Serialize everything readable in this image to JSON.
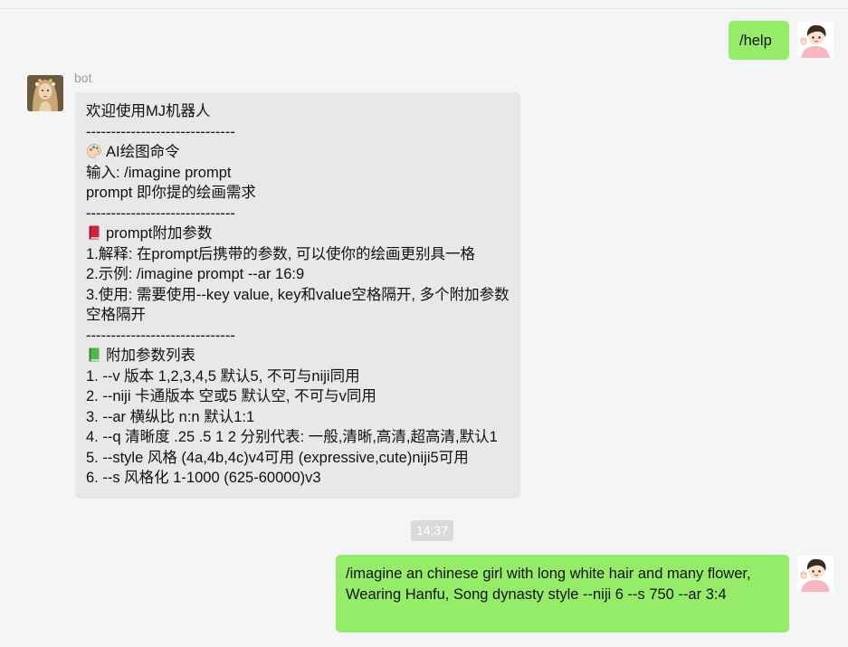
{
  "chat": {
    "user_help_message": "/help",
    "bot_sender_name": "bot",
    "bot_reply_lines": [
      "欢迎使用MJ机器人",
      "------------------------------",
      "🎨 AI绘图命令",
      "输入: /imagine prompt",
      "prompt 即你提的绘画需求",
      "------------------------------",
      "📕 prompt附加参数",
      "1.解释: 在prompt后携带的参数, 可以使你的绘画更别具一格",
      "2.示例: /imagine prompt --ar 16:9",
      "3.使用: 需要使用--key value, key和value空格隔开, 多个附加参数空格隔开",
      "------------------------------",
      "📗 附加参数列表",
      "1. --v 版本 1,2,3,4,5 默认5, 不可与niji同用",
      "2. --niji 卡通版本 空或5 默认空, 不可与v同用",
      "3. --ar 横纵比 n:n 默认1:1",
      "4. --q 清晰度 .25 .5 1 2 分别代表: 一般,清晰,高清,超高清,默认1",
      "5. --style 风格 (4a,4b,4c)v4可用 (expressive,cute)niji5可用",
      "6. --s 风格化 1-1000 (625-60000)v3"
    ],
    "timestamp": "14:37",
    "user_imagine_message": "/imagine an chinese girl with long white hair and many flower, Wearing Hanfu, Song dynasty style --niji 6 --s 750 --ar 3:4"
  },
  "colors": {
    "background": "#f5f5f5",
    "user_bubble": "#95ec69",
    "bot_bubble": "#e8e8e8",
    "sender_name": "#9c9c9c",
    "timestamp_bg": "#dadada"
  },
  "icons": {
    "user_avatar": "cartoon-boy-waving-avatar",
    "bot_avatar": "girl-portrait-avatar",
    "palette": "palette-emoji",
    "red_book": "closed-red-book-emoji",
    "green_book": "green-book-emoji"
  }
}
